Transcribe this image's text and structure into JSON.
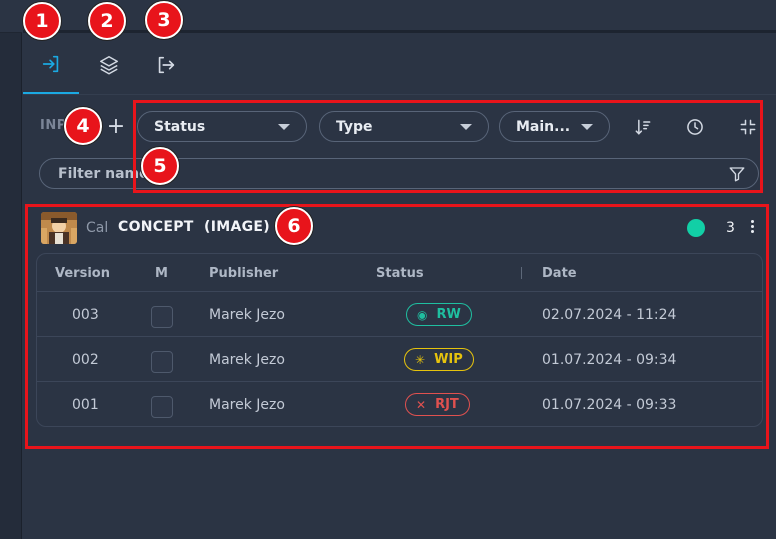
{
  "tabs": [
    {
      "name": "loader-tab",
      "icon": "sign-in-icon",
      "active": true
    },
    {
      "name": "layers-tab",
      "icon": "layers-icon",
      "active": false
    },
    {
      "name": "publish-tab",
      "icon": "sign-out-icon",
      "active": false
    }
  ],
  "toolbar": {
    "add_label": "INP",
    "plus_label": "+",
    "status_label": "Status",
    "type_label": "Type",
    "main_label": "Main...",
    "sort_icon": "sort-descending-icon",
    "history_icon": "clock-icon",
    "collapse_icon": "collapse-icon"
  },
  "filter": {
    "placeholder": "Filter name",
    "value": "",
    "icon": "filter-icon"
  },
  "product": {
    "name": "Cal",
    "title": "CONCEPT",
    "type": "(IMAGE)",
    "status_color": "#12cfa6",
    "version_count": "3"
  },
  "table": {
    "columns": [
      "Version",
      "M",
      "Publisher",
      "Status",
      "Date"
    ],
    "rows": [
      {
        "version": "003",
        "publisher": "Marek Jezo",
        "status": "RW",
        "status_icon": "eye-icon",
        "status_color": "#1fbfa0",
        "date": "02.07.2024 - 11:24"
      },
      {
        "version": "002",
        "publisher": "Marek Jezo",
        "status": "WIP",
        "status_icon": "spinner-icon",
        "status_color": "#e6c30d",
        "date": "01.07.2024 - 09:34"
      },
      {
        "version": "001",
        "publisher": "Marek Jezo",
        "status": "RJT",
        "status_icon": "close-icon",
        "status_color": "#e0514f",
        "date": "01.07.2024 - 09:33"
      }
    ]
  },
  "annotations": {
    "n1": "1",
    "n2": "2",
    "n3": "3",
    "n4": "4",
    "n5": "5",
    "n6": "6"
  },
  "colors": {
    "accent": "#1ba9e2",
    "background": "#2b3444",
    "highlight": "#e8141b"
  }
}
